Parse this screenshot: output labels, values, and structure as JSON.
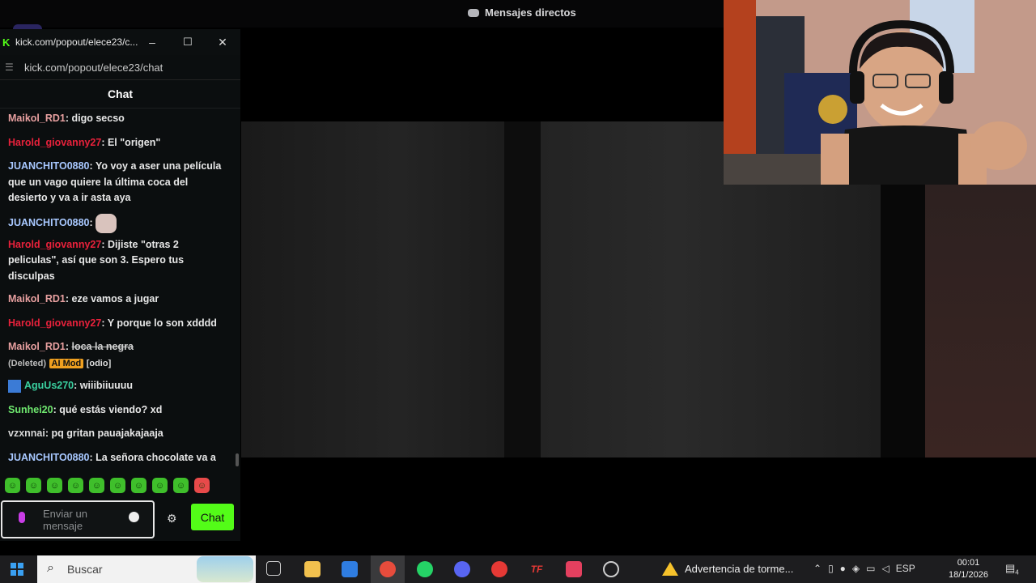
{
  "top_bar": {
    "title": "Mensajes directos"
  },
  "popout": {
    "title": "kick.com/popout/elece23/c...",
    "address": "kick.com/popout/elece23/chat",
    "controls": {
      "minimize": "–",
      "maximize": "☐",
      "close": "✕"
    }
  },
  "chat": {
    "header": "Chat",
    "messages": [
      {
        "user": "Maikol_RD1",
        "color": "#e8a0a0",
        "text": "digo secso"
      },
      {
        "user": "Harold_giovanny27",
        "color": "#e8213b",
        "text": "El \"origen\""
      },
      {
        "user": "JUANCHITO0880",
        "color": "#a8c8ff",
        "text": "Yo voy a aser una película que un vago quiere la última coca del desierto y va a ir asta aya"
      },
      {
        "user": "JUANCHITO0880",
        "color": "#a8c8ff",
        "text": ""
      },
      {
        "user": "Harold_giovanny27",
        "color": "#e8213b",
        "text": "Dijiste \"otras 2 peliculas\", así que son 3. Espero tus disculpas"
      },
      {
        "user": "Maikol_RD1",
        "color": "#e8a0a0",
        "text": "eze vamos a jugar"
      },
      {
        "user": "Harold_giovanny27",
        "color": "#e8213b",
        "text": "Y porque lo son xdddd"
      },
      {
        "user": "Maikol_RD1",
        "color": "#e8a0a0",
        "text": "loca la negra",
        "deleted": "(Deleted)",
        "badge": "AI Mod",
        "tag": "[odio]"
      },
      {
        "user": "AguUs270",
        "color": "#3ad0a0",
        "text": "wiiibiiuuuu"
      },
      {
        "user": "Sunhei20",
        "color": "#6fe86f",
        "text": "qué estás viendo? xd"
      },
      {
        "user": "vzxnnai",
        "color": "#d8d8d8",
        "text": "pq gritan pauajakajaaja"
      },
      {
        "user": "JUANCHITO0880",
        "color": "#a8c8ff",
        "text": "La señora chocolate va a quedar así si sigue buscando la última piza"
      }
    ],
    "input_placeholder": "Enviar un mensaje",
    "send_label": "Chat"
  },
  "taskbar": {
    "search_label": "Buscar",
    "weather": "Advertencia de torme...",
    "language": "ESP",
    "time": "00:01",
    "date": "18/1/2026",
    "notifications": "4"
  }
}
